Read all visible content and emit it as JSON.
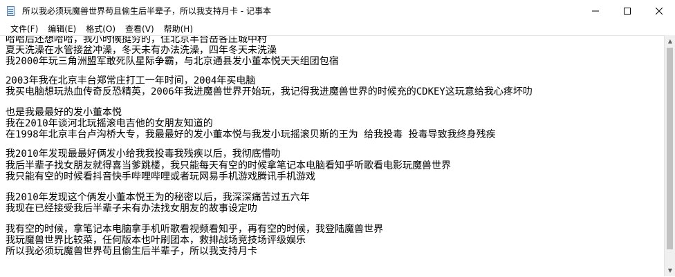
{
  "window": {
    "title": "所以我必须玩魔兽世界苟且偷生后半辈子，所以我支持月卡 - 记事本"
  },
  "controls": {
    "minimize": "─",
    "maximize": "☐",
    "close": "✕"
  },
  "menu": [
    "文件(F)",
    "编辑(E)",
    "格式(O)",
    "查看(V)",
    "帮助(H)"
  ],
  "lines": [
    "哈哈后还想哈哈，我小时候挺穷的，住北京丰台岳各庄城中村",
    "夏天洗澡在水管接盆冲澡，冬天未有办法洗澡，四年冬天未洗澡",
    "我2000年玩三角洲盟军敢死队星际争霸，与北京通县发小董本悦天天组团包宿",
    "",
    "2003年我在北京丰台郑常庄打工一年时间，2004年买电脑",
    "我买电脑想玩热血传奇反恐精英，2006年我进魔兽世界开始玩，我记得我进魔兽世界的时候充的CDKEY这玩意给我心疼坏叻",
    "",
    "也是我最最好的发小董本悦",
    "我在2010年谈河北玩摇滚电吉他的女朋友知道的",
    "在1998年北京丰台卢沟桥大专，我最最好的发小董本悦与我发小玩摇滚贝斯的王为 给我投毒 投毒导致我终身残疾",
    "",
    "我2010年发现最最好俩发小给我我投毒我残疾以后，我彻底懵叻",
    "我后半辈子找女朋友就得喜当爹跳楼，我只能每天有空的时候拿笔记本电脑看知乎听歌看电影玩魔兽世界",
    "我只能有空的时候看抖音快手哔哩哔哩或者玩网易手机游戏腾讯手机游戏",
    "",
    "我2010年发现这个俩发小董本悦王为的秘密以后，我深深痛苦过五六年",
    "我现在已经接受我后半辈子未有办法找女朋友的故事设定叻",
    "",
    "我有空的时候，拿笔记本电脑拿手机听歌看视频看知乎，再有空的时候，我登陆魔兽世界",
    "我玩魔兽世界比较菜，任何版本也叶刷团本，救排战场竞技场评级娱乐",
    "所以我必须玩魔兽世界苟且偷生后半辈子，所以我支持月卡"
  ]
}
